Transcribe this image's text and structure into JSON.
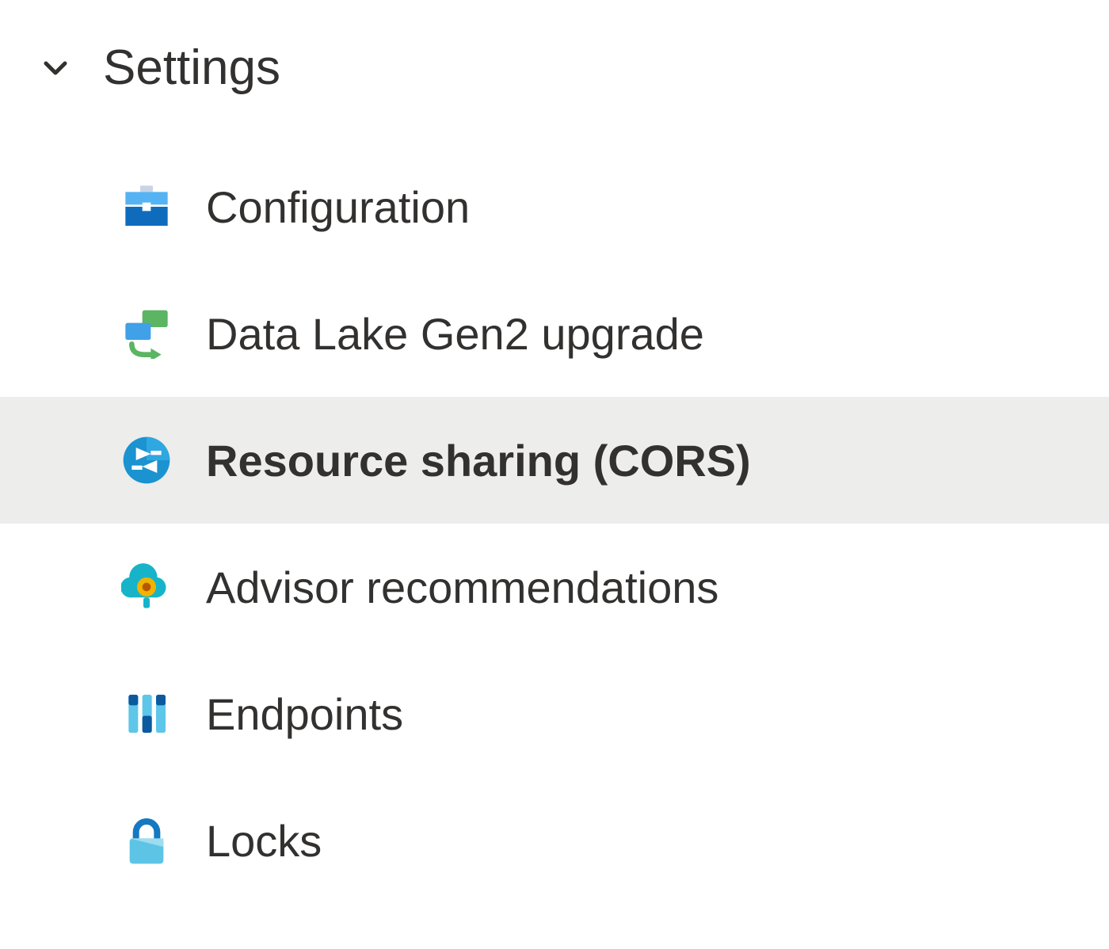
{
  "section": {
    "title": "Settings",
    "expanded": true
  },
  "items": [
    {
      "label": "Configuration",
      "icon": "toolbox-icon",
      "selected": false
    },
    {
      "label": "Data Lake Gen2 upgrade",
      "icon": "upgrade-icon",
      "selected": false
    },
    {
      "label": "Resource sharing (CORS)",
      "icon": "cors-icon",
      "selected": true
    },
    {
      "label": "Advisor recommendations",
      "icon": "advisor-icon",
      "selected": false
    },
    {
      "label": "Endpoints",
      "icon": "endpoints-icon",
      "selected": false
    },
    {
      "label": "Locks",
      "icon": "lock-icon",
      "selected": false
    }
  ],
  "colors": {
    "selected_bg": "#ededeb",
    "text": "#323130"
  }
}
